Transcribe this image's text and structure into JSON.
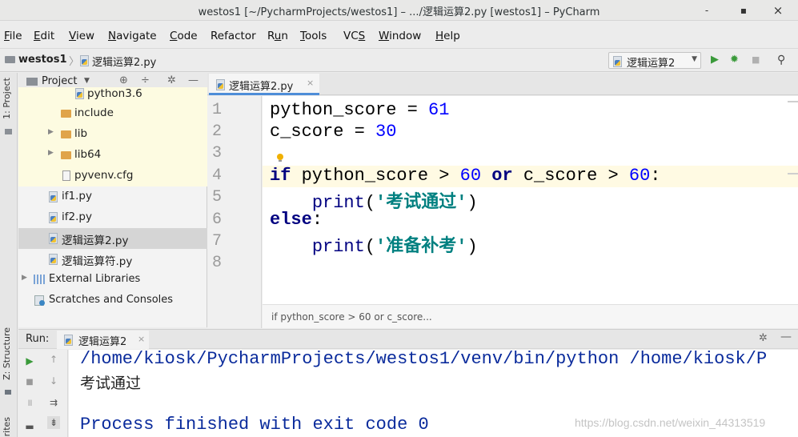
{
  "window": {
    "title": "westos1 [~/PycharmProjects/westos1] – .../逻辑运算2.py [westos1] – PyCharm",
    "minimize": "-",
    "maximize": "▪",
    "close": "×"
  },
  "menu": [
    {
      "pre": "",
      "u": "F",
      "post": "ile"
    },
    {
      "pre": "",
      "u": "E",
      "post": "dit"
    },
    {
      "pre": "",
      "u": "V",
      "post": "iew"
    },
    {
      "pre": "",
      "u": "N",
      "post": "avigate"
    },
    {
      "pre": "",
      "u": "C",
      "post": "ode"
    },
    {
      "pre": "Refactor",
      "u": "",
      "post": ""
    },
    {
      "pre": "R",
      "u": "u",
      "post": "n"
    },
    {
      "pre": "",
      "u": "T",
      "post": "ools"
    },
    {
      "pre": "VC",
      "u": "S",
      "post": ""
    },
    {
      "pre": "",
      "u": "W",
      "post": "indow"
    },
    {
      "pre": "",
      "u": "H",
      "post": "elp"
    }
  ],
  "navbar": {
    "project": "westos1",
    "separator": "〉",
    "file": "逻辑运算2.py",
    "run_config": "逻辑运算2",
    "run_arrow": "▼",
    "run_icon": "▶",
    "debug_icon": "✹",
    "stop_icon": "■",
    "search_icon": "⚲"
  },
  "side_tabs": {
    "project": "1: Project",
    "structure": "Z: Structure",
    "favorites": "rites"
  },
  "project_panel": {
    "title": "Project",
    "arrow": "▼",
    "btn_target": "⊕",
    "btn_collapse": "÷",
    "btn_settings": "✲",
    "btn_hide": "—",
    "tree": [
      {
        "label": "python3.6",
        "icon": "py-file-icon"
      },
      {
        "label": "include",
        "icon": "folder-icon"
      },
      {
        "label": "lib",
        "icon": "folder-icon",
        "arrow": "▶"
      },
      {
        "label": "lib64",
        "icon": "folder-link-icon",
        "arrow": "▶"
      },
      {
        "label": "pyvenv.cfg",
        "icon": "config-file-icon"
      },
      {
        "label": "if1.py",
        "icon": "py-file-icon"
      },
      {
        "label": "if2.py",
        "icon": "py-file-icon"
      },
      {
        "label": "逻辑运算2.py",
        "icon": "py-file-icon"
      },
      {
        "label": "逻辑运算符.py",
        "icon": "py-file-icon"
      },
      {
        "label": "External Libraries",
        "icon": "library-icon",
        "arrow": "▶"
      },
      {
        "label": "Scratches and Consoles",
        "icon": "scratches-icon"
      }
    ]
  },
  "editor": {
    "tab_label": "逻辑运算2.py",
    "tab_close": "×",
    "line_numbers": [
      "1",
      "2",
      "3",
      "4",
      "5",
      "6",
      "7",
      "8"
    ],
    "code": {
      "l1_var": "python_score = ",
      "l1_num": "61",
      "l2_var": "c_score = ",
      "l2_num": "30",
      "l4_if": "if",
      "l4_a": " python_score > ",
      "l4_n1": "60",
      "l4_sp": " ",
      "l4_or": "or",
      "l4_b": " c_score > ",
      "l4_n2": "60",
      "l4_colon": ":",
      "l5_indent": "    ",
      "l5_fn": "print",
      "l5_open": "(",
      "l5_str": "'考试通过'",
      "l5_close": ")",
      "l6_else": "else",
      "l6_colon": ":",
      "l7_indent": "    ",
      "l7_fn": "print",
      "l7_open": "(",
      "l7_str": "'准备补考'",
      "l7_close": ")"
    },
    "breadcrumb": "if python_score > 60 or c_score..."
  },
  "run_panel": {
    "label": "Run:",
    "tab_label": "逻辑运算2",
    "tab_close": "×",
    "gear": "✲",
    "minimize": "—",
    "tools": {
      "rerun": "▶",
      "up": "↑",
      "stop": "■",
      "down": "↓",
      "pause": "॥",
      "soft_wrap": "⇉",
      "pin": "▬",
      "scroll_end": "⇟"
    },
    "console": [
      "/home/kiosk/PycharmProjects/westos1/venv/bin/python /home/kiosk/P",
      "考试通过",
      "",
      "Process finished with exit code 0"
    ]
  },
  "watermark": "https://blog.csdn.net/weixin_44313519",
  "colors": {
    "keyword": "#000080",
    "number": "#0000ff",
    "string": "#008080",
    "console_text": "#0a2b9c",
    "selection": "#d5d5d5",
    "current_line": "#fffae3",
    "tab_underline": "#4e8dd8"
  }
}
